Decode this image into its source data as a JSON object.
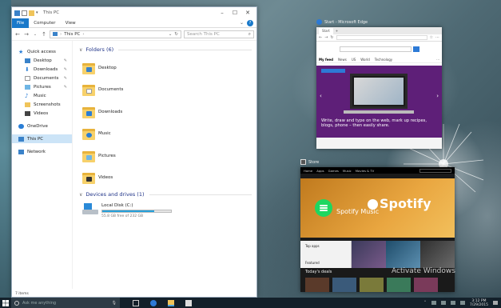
{
  "explorer": {
    "title": "This PC",
    "ribbon_tabs": [
      "File",
      "Computer",
      "View"
    ],
    "help": "?",
    "address": "This PC",
    "search_placeholder": "Search This PC",
    "nav": {
      "quick_access": "Quick access",
      "quick_items": [
        "Desktop",
        "Downloads",
        "Documents",
        "Pictures",
        "Music",
        "Screenshots",
        "Videos"
      ],
      "onedrive": "OneDrive",
      "this_pc": "This PC",
      "network": "Network"
    },
    "folders_header": "Folders (6)",
    "folders": [
      "Desktop",
      "Documents",
      "Downloads",
      "Music",
      "Pictures",
      "Videos"
    ],
    "drives_header": "Devices and drives (1)",
    "drive": {
      "name": "Local Disk (C:)",
      "free": "55.8 GB free of 232 GB",
      "used_fraction": 0.76
    },
    "status": "7 items"
  },
  "edge": {
    "label": "Start - Microsoft Edge",
    "tab": "Start",
    "nav": [
      "My feed",
      "News",
      "US",
      "World",
      "Technology"
    ],
    "hero_caption": "Write, draw and type on the web, mark up recipes, blogs, phone – then easily share."
  },
  "store": {
    "label": "Store",
    "top_nav": [
      "Home",
      "Apps",
      "Games",
      "Music",
      "Movies & TV"
    ],
    "hero_app": "Spotify Music",
    "hero_logo": "Spotify",
    "row_labels": [
      "Top apps",
      "Featured"
    ],
    "deals": "Today's deals"
  },
  "watermark": "Activate Windows",
  "taskbar": {
    "search_placeholder": "Ask me anything",
    "time": "3:12 PM",
    "date": "7/29/2015"
  }
}
